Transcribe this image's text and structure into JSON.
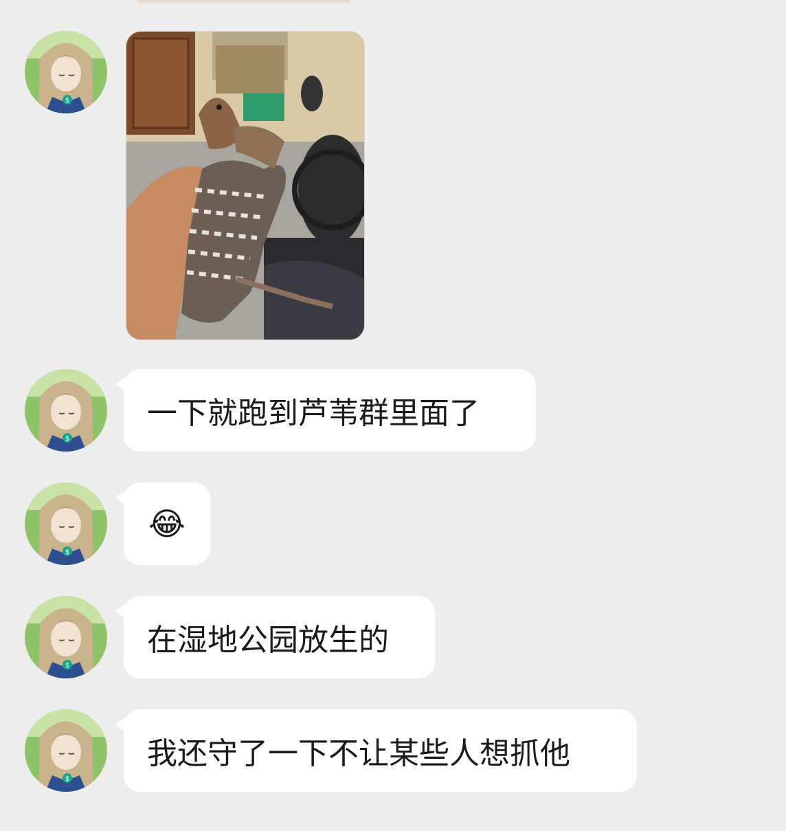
{
  "messages": [
    {
      "type": "image",
      "alt_icon": "bird-photo"
    },
    {
      "type": "text",
      "text": "一下就跑到芦苇群里面了"
    },
    {
      "type": "text",
      "text": "😂"
    },
    {
      "type": "text",
      "text": "在湿地公园放生的"
    },
    {
      "type": "text",
      "text": "我还守了一下不让某些人想抓他"
    }
  ],
  "colors": {
    "background": "#ededed",
    "bubble": "#ffffff",
    "text": "#1b1b1b"
  }
}
